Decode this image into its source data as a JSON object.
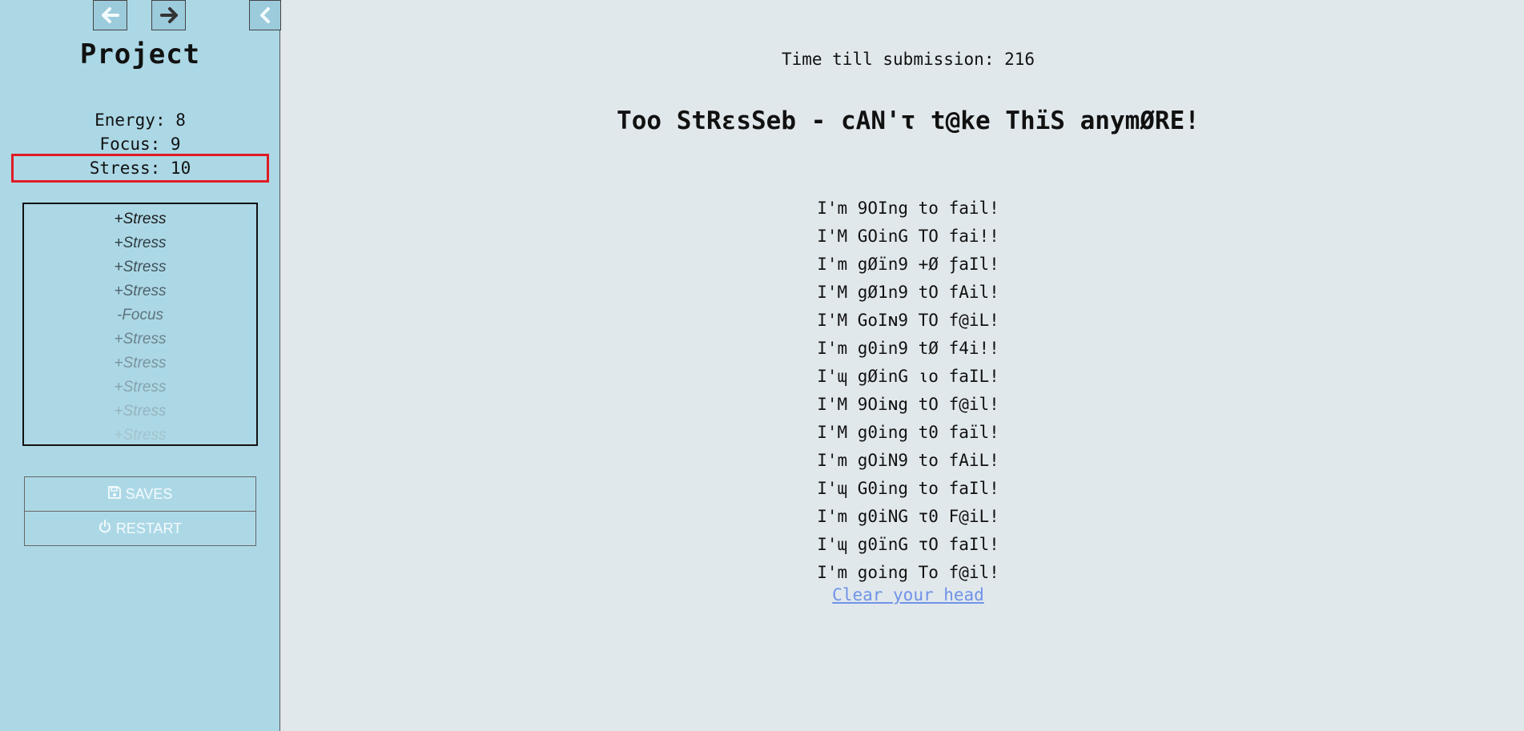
{
  "sidebar": {
    "title": "Project",
    "stats": {
      "energy": "Energy: 8",
      "focus": "Focus: 9",
      "stress": "Stress: 10"
    },
    "history": [
      {
        "label": "+Stress",
        "color": "#1a1a1a"
      },
      {
        "label": "+Stress",
        "color": "#2f3e45"
      },
      {
        "label": "+Stress",
        "color": "#3f5058"
      },
      {
        "label": "+Stress",
        "color": "#4f626b"
      },
      {
        "label": "-Focus",
        "color": "#5e737c"
      },
      {
        "label": "+Stress",
        "color": "#6d838d"
      },
      {
        "label": "+Stress",
        "color": "#7a939d"
      },
      {
        "label": "+Stress",
        "color": "#87a3ad"
      },
      {
        "label": "+Stress",
        "color": "#95b3bd"
      },
      {
        "label": "+Stress",
        "color": "#a3c3cc"
      }
    ],
    "saves_label": "SAVES",
    "restart_label": "RESTART",
    "icons": {
      "back": "arrow-left-icon",
      "forward": "arrow-right-icon",
      "collapse": "chevron-left-icon",
      "saves": "floppy-disk-icon",
      "restart": "power-icon"
    }
  },
  "main": {
    "timer": "Time till submission: 216",
    "heading": "Too StRεsSeb - cAN'τ t@ke ThïS anymØRE!",
    "lines": [
      "I'm 9OIng to fail!",
      "I'M GOinG TO fai!!",
      "I'm gØïn9 +Ø ƒaIl!",
      "I'M gØ1n9 tO fAil!",
      "I'M GoIɴ9 TO f@iL!",
      "I'm g0in9 tØ f4i!!",
      "I'ɰ gØinG ιo faIL!",
      "I'M 9Oiɴg tO f@il!",
      "I'M g0ing t0 faïl!",
      "I'm gOiN9 to fAiL!",
      "I'ɰ G0ing to faIl!",
      "I'm g0iNG τ0 F@iL!",
      "I'ɰ g0ïnG τO faIl!",
      "I'm going To f@il!"
    ],
    "link_label": "Clear your head"
  },
  "colors": {
    "sidebar_bg": "#acd8e6",
    "main_bg": "#e1e8ec",
    "highlight_border": "#e01b24",
    "link": "#6f93e6"
  }
}
